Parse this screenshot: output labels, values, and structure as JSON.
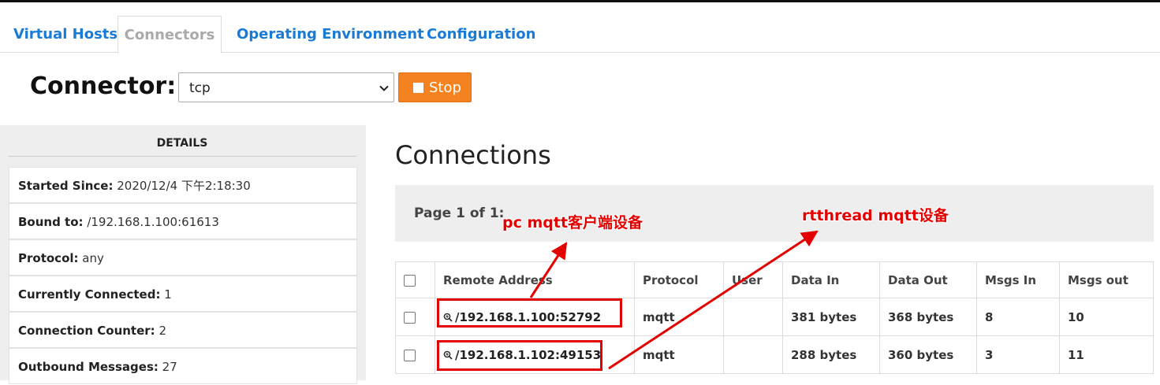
{
  "tabs": [
    {
      "label": "Virtual Hosts",
      "active": false
    },
    {
      "label": "Connectors",
      "active": true
    },
    {
      "label": "Operating Environment",
      "active": false
    },
    {
      "label": "Configuration",
      "active": false
    }
  ],
  "connector": {
    "label": "Connector:",
    "selected": "tcp",
    "stop_label": "Stop"
  },
  "details": {
    "title": "DETAILS",
    "rows": [
      {
        "label": "Started Since:",
        "value": "2020/12/4 下午2:18:30"
      },
      {
        "label": "Bound to:",
        "value": "/192.168.1.100:61613"
      },
      {
        "label": "Protocol:",
        "value": "any"
      },
      {
        "label": "Currently Connected:",
        "value": "1"
      },
      {
        "label": "Connection Counter:",
        "value": "2"
      },
      {
        "label": "Outbound Messages:",
        "value": "27"
      }
    ]
  },
  "connections": {
    "title": "Connections",
    "pager": "Page 1 of 1:",
    "columns": [
      "Remote Address",
      "Protocol",
      "User",
      "Data In",
      "Data Out",
      "Msgs In",
      "Msgs out"
    ],
    "rows": [
      {
        "address": "/192.168.1.100:52792",
        "protocol": "mqtt",
        "user": "",
        "data_in": "381 bytes",
        "data_out": "368 bytes",
        "msgs_in": "8",
        "msgs_out": "10"
      },
      {
        "address": "/192.168.1.102:49153",
        "protocol": "mqtt",
        "user": "",
        "data_in": "288 bytes",
        "data_out": "360 bytes",
        "msgs_in": "3",
        "msgs_out": "11"
      }
    ]
  },
  "annotations": {
    "pc_label": "pc  mqtt客户端设备",
    "rt_label": "rtthread mqtt设备",
    "color": "#e30000"
  },
  "colors": {
    "link": "#1a7bd6",
    "stop_button": "#f58220",
    "panel_bg": "#eeeeee"
  },
  "icons": {
    "stop": "stop-square-icon",
    "zoom": "magnifier-icon",
    "select": "chevron-down-icon"
  }
}
